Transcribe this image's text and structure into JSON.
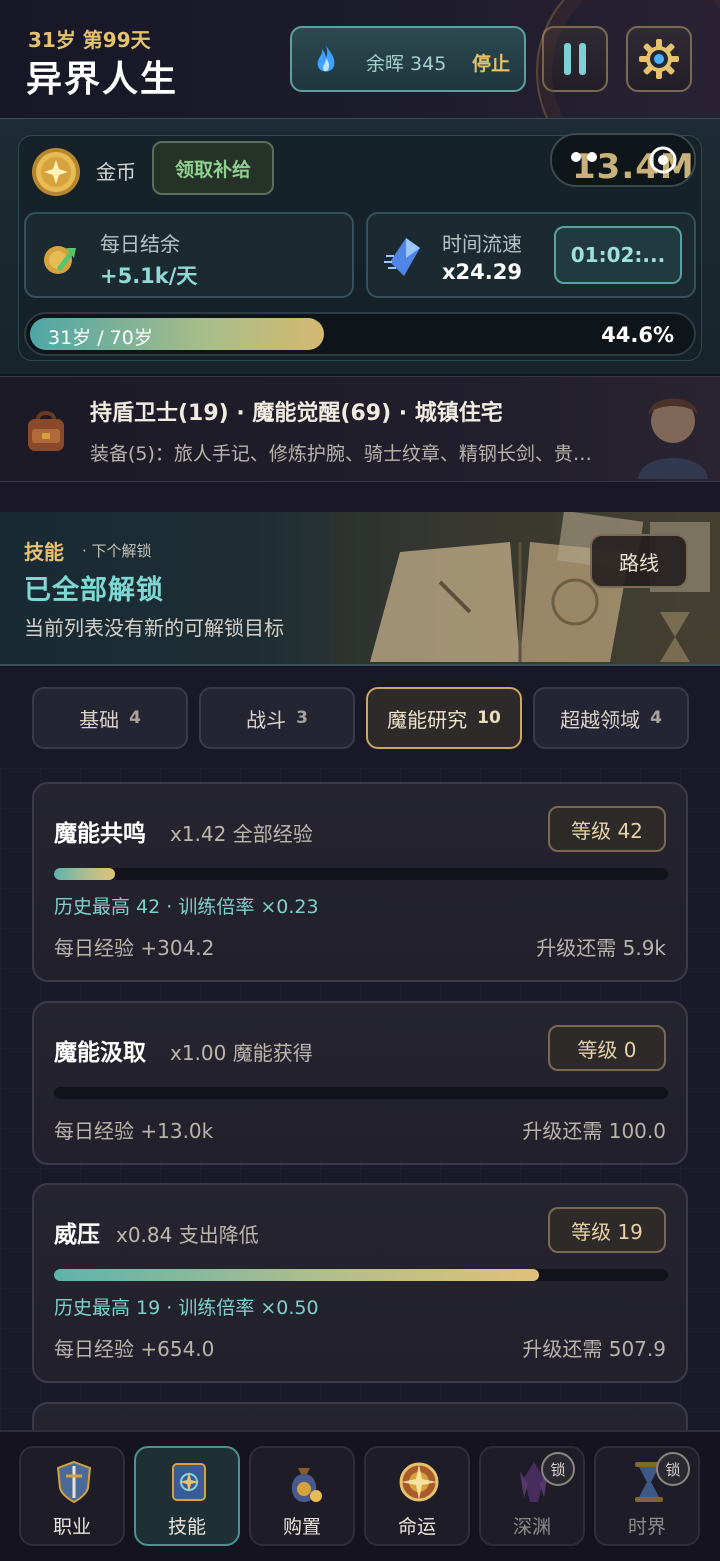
{
  "header": {
    "age_day": "31岁 第99天",
    "title": "异界人生",
    "ember_label": "余晖 345",
    "stop_label": "停止"
  },
  "resources": {
    "gold_label": "金币",
    "supply_button": "领取补给",
    "gold_value": "13.4M",
    "daily_label": "每日结余",
    "daily_value": "+5.1k/天",
    "speed_label": "时间流速",
    "speed_value": "x24.29",
    "timer": "01:02:...",
    "age_progress_label": "31岁 / 70岁",
    "age_progress_pct": "44.6%",
    "age_progress_fraction": 0.446
  },
  "career": {
    "title": "持盾卫士(19) · 魔能觉醒(69) · 城镇住宅",
    "equipment": "装备(5)：旅人手记、修炼护腕、骑士纹章、精钢长剑、贵…"
  },
  "skills_banner": {
    "tag": "技能",
    "next": "· 下个解锁",
    "heading": "已全部解锁",
    "sub": "当前列表没有新的可解锁目标",
    "route_button": "路线"
  },
  "tabs": [
    {
      "label": "基础",
      "count": "4",
      "active": false
    },
    {
      "label": "战斗",
      "count": "3",
      "active": false
    },
    {
      "label": "魔能研究",
      "count": "10",
      "active": true
    },
    {
      "label": "超越领域",
      "count": "4",
      "active": false
    }
  ],
  "skills": [
    {
      "name": "魔能共鸣",
      "effect": "x1.42 全部经验",
      "level": "等级 42",
      "progress": 0.1,
      "history": "历史最高 42 · 训练倍率 ×0.23",
      "daily": "每日经验 +304.2",
      "need": "升级还需 5.9k"
    },
    {
      "name": "魔能汲取",
      "effect": "x1.00 魔能获得",
      "level": "等级 0",
      "progress": 0.0,
      "history": "",
      "daily": "每日经验 +13.0k",
      "need": "升级还需 100.0"
    },
    {
      "name": "威压",
      "effect": "x0.84 支出降低",
      "level": "等级 19",
      "progress": 0.79,
      "history": "历史最高 19 · 训练倍率 ×0.50",
      "daily": "每日经验 +654.0",
      "need": "升级还需 507.9"
    }
  ],
  "nav": [
    {
      "label": "职业",
      "icon": "shield-sword-icon",
      "active": false,
      "locked": false
    },
    {
      "label": "技能",
      "icon": "spellbook-icon",
      "active": true,
      "locked": false
    },
    {
      "label": "购置",
      "icon": "money-bag-icon",
      "active": false,
      "locked": false
    },
    {
      "label": "命运",
      "icon": "fate-compass-icon",
      "active": false,
      "locked": false
    },
    {
      "label": "深渊",
      "icon": "abyss-crystal-icon",
      "active": false,
      "locked": true,
      "lock_label": "锁"
    },
    {
      "label": "时界",
      "icon": "hourglass-icon",
      "active": false,
      "locked": true,
      "lock_label": "锁"
    }
  ],
  "colors": {
    "accent_teal": "#7fd8d4",
    "accent_gold": "#e6c16e",
    "positive_green": "#8fcf8f"
  }
}
